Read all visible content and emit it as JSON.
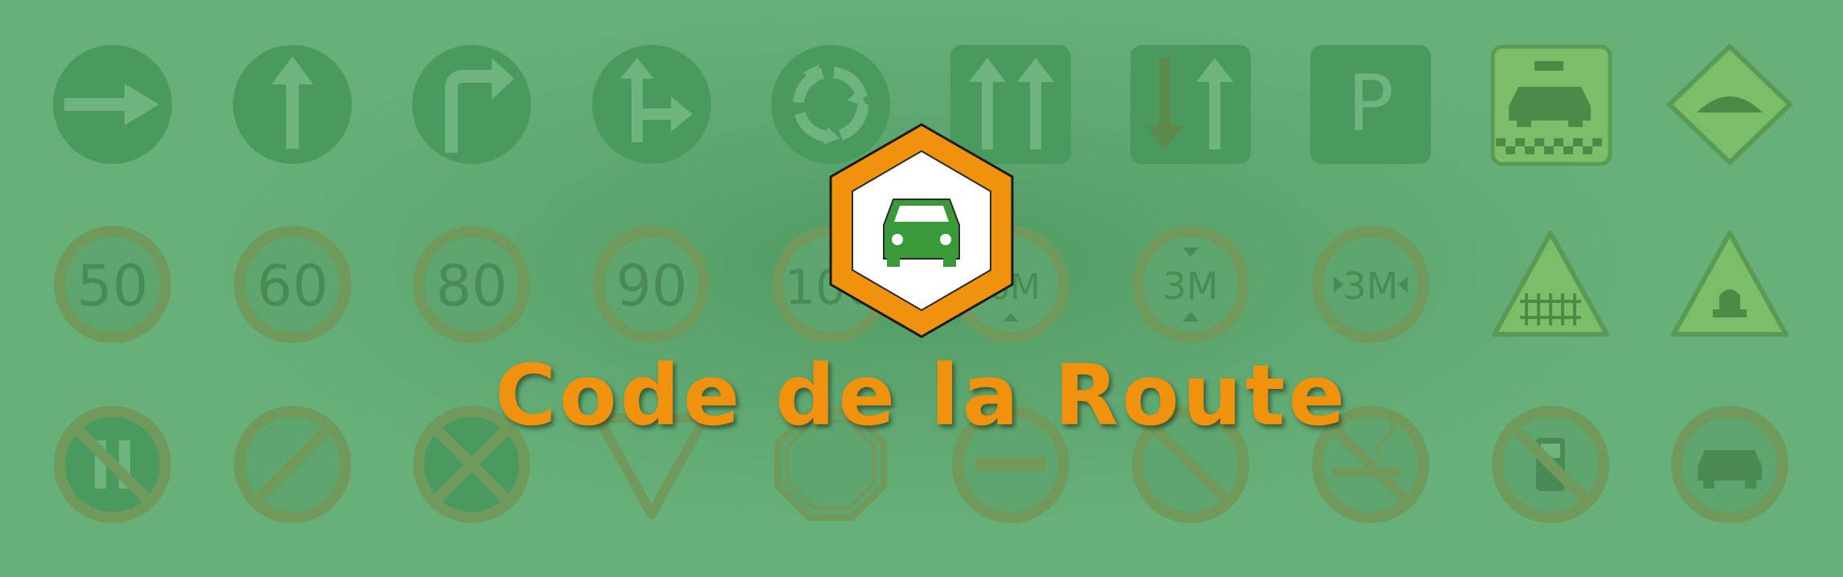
{
  "title": "Code de la Route",
  "colors": {
    "background": "#67b07a",
    "sign_fill": "#4a9a60",
    "sign_ring": "#6f9a5c",
    "accent": "#f0920e",
    "logo_car": "#3a9a3a"
  },
  "logo": {
    "icon": "car-icon"
  },
  "speed_limits": [
    "50",
    "60",
    "80",
    "90",
    "100"
  ],
  "dimension_labels": {
    "height_limit": "3M",
    "width_limit": "3M",
    "length_limit": "6M"
  },
  "parking_letter": "P",
  "sign_icons": [
    "arrow-right-icon",
    "arrow-up-icon",
    "turn-right-icon",
    "left-right-split-icon",
    "roundabout-icon",
    "two-arrows-up-icon",
    "arrow-down-up-icon",
    "parking-icon",
    "taxi-icon",
    "speed-bump-icon",
    "speed-50-icon",
    "speed-60-icon",
    "speed-80-icon",
    "speed-90-icon",
    "speed-100-icon",
    "length-limit-icon",
    "height-limit-icon",
    "width-limit-icon",
    "railway-crossing-icon",
    "warning-light-icon",
    "no-overtaking-icon",
    "end-restrictions-icon",
    "no-stopping-icon",
    "yield-icon",
    "stop-icon",
    "no-entry-icon",
    "no-parking-icon",
    "no-smoking-icon",
    "no-phone-icon",
    "no-car-icon"
  ]
}
